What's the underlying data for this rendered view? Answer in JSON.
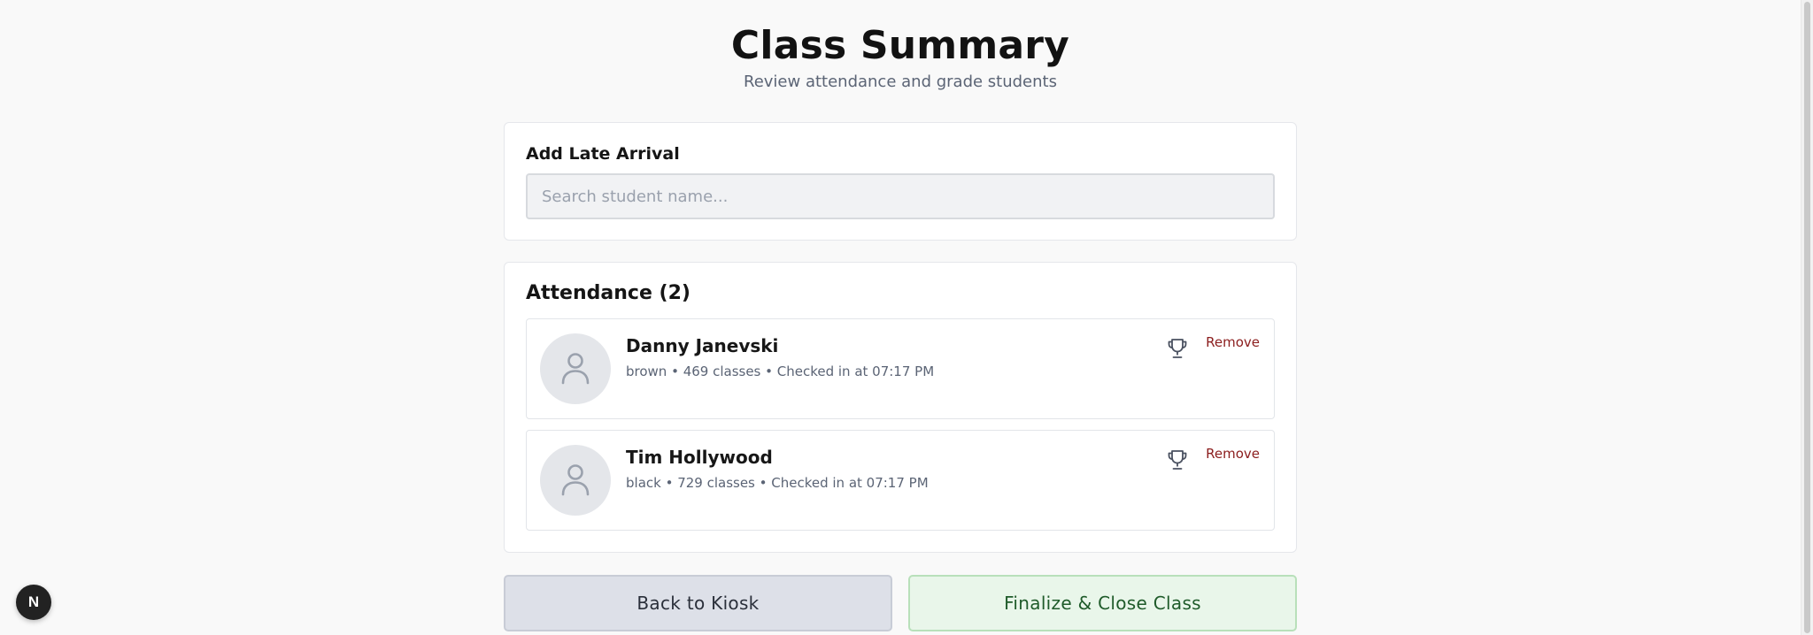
{
  "header": {
    "title": "Class Summary",
    "subtitle": "Review attendance and grade students"
  },
  "late_arrival": {
    "title": "Add Late Arrival",
    "search_placeholder": "Search student name...",
    "search_value": ""
  },
  "attendance": {
    "title": "Attendance (2)",
    "students": [
      {
        "name": "Danny Janevski",
        "meta": "brown • 469 classes • Checked in at 07:17 PM",
        "grade_icon": "trophy-icon",
        "remove_label": "Remove",
        "avatar_icon": "user-icon"
      },
      {
        "name": "Tim Hollywood",
        "meta": "black • 729 classes • Checked in at 07:17 PM",
        "grade_icon": "trophy-icon",
        "remove_label": "Remove",
        "avatar_icon": "user-icon"
      }
    ]
  },
  "actions": {
    "back_label": "Back to Kiosk",
    "finalize_label": "Finalize & Close Class"
  },
  "badge": {
    "label": "N"
  },
  "colors": {
    "remove": "#8b1d1d",
    "finalize_bg": "#e9f6ea",
    "finalize_border": "#b8e0ba",
    "back_bg": "#dde0e8",
    "avatar_bg": "#e4e6ea"
  }
}
